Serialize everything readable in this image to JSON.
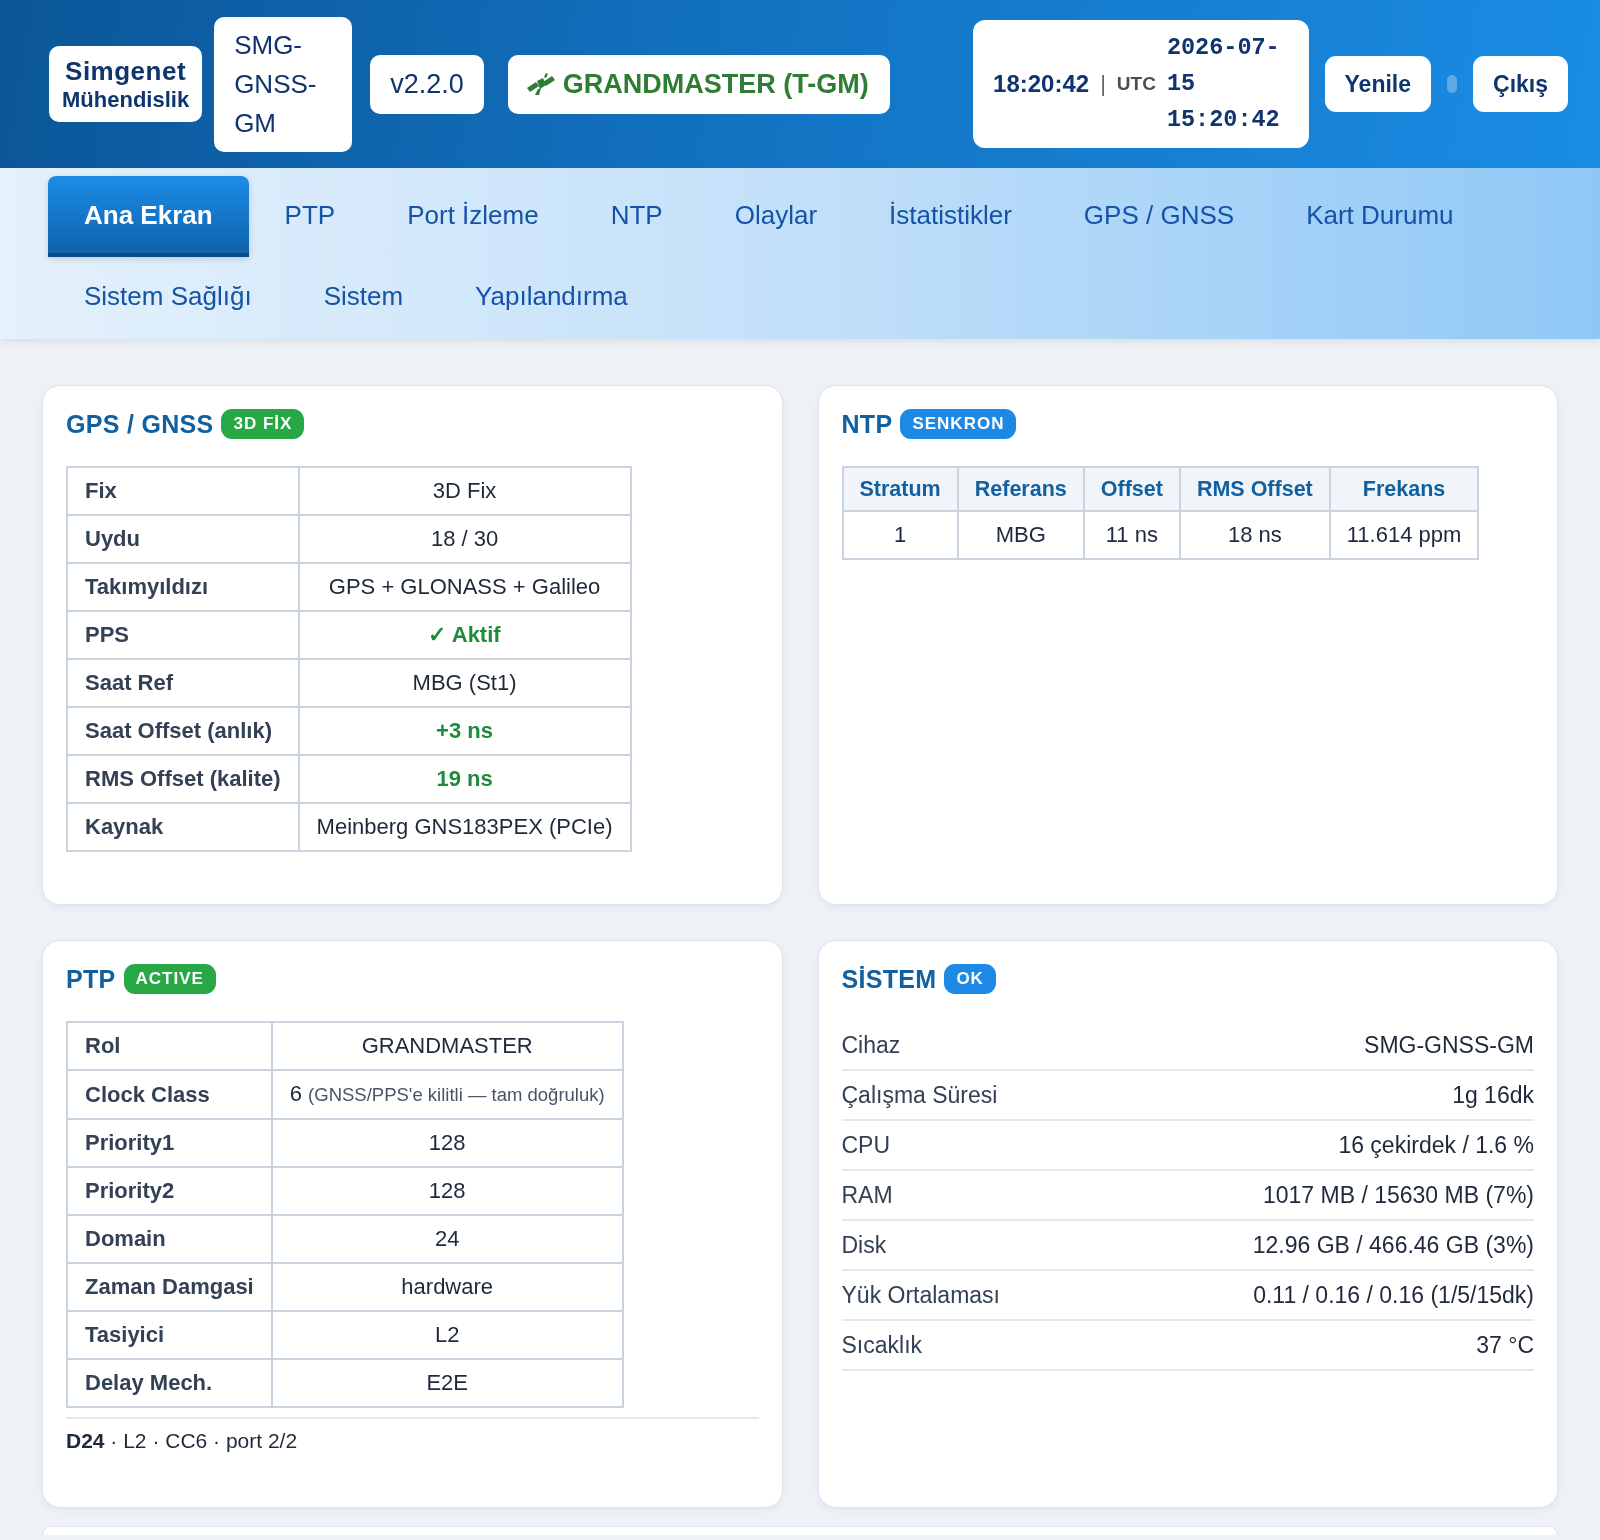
{
  "header": {
    "logo": {
      "name": "Simgenet",
      "subtitle": "Mühendislik"
    },
    "device": "SMG-GNSS-GM",
    "version": "v2.2.0",
    "role": "GRANDMASTER (T-GM)",
    "clock": {
      "local": "18:20:42",
      "separator": "|",
      "zone": "UTC",
      "utc": "2026-07-15 15:20:42"
    },
    "buttons": [
      "Yenile",
      "Çıkış"
    ]
  },
  "nav": {
    "tabs": [
      {
        "label": "Ana Ekran",
        "selected": true
      },
      {
        "label": "PTP",
        "selected": false
      },
      {
        "label": "Port İzleme",
        "selected": false
      },
      {
        "label": "NTP",
        "selected": false
      },
      {
        "label": "Olaylar",
        "selected": false
      },
      {
        "label": "İstatistikler",
        "selected": false
      },
      {
        "label": "GPS / GNSS",
        "selected": false
      },
      {
        "label": "Kart Durumu",
        "selected": false
      },
      {
        "label": "Sistem Sağlığı",
        "selected": false
      },
      {
        "label": "Sistem",
        "selected": false
      },
      {
        "label": "Yapılandırma",
        "selected": false
      }
    ]
  },
  "cards": [
    {
      "kind": "kv_table",
      "title": "GPS / GNSS",
      "badge": {
        "text": "3D FİX",
        "color": "#28a745"
      },
      "rows": [
        {
          "label": "Fix",
          "value": "3D Fix",
          "kind": "plain"
        },
        {
          "label": "Uydu",
          "value": "18 / 30",
          "kind": "plain"
        },
        {
          "label": "Takımyıldızı",
          "value": "GPS + GLONASS + Galileo",
          "kind": "plain"
        },
        {
          "label": "PPS",
          "value": "✓ Aktif",
          "kind": "good"
        },
        {
          "label": "Saat Ref",
          "value": "MBG (St1)",
          "kind": "plain"
        },
        {
          "label": "Saat Offset (anlık)",
          "value": "+3 ns",
          "kind": "good"
        },
        {
          "label": "RMS Offset (kalite)",
          "value": "19 ns",
          "kind": "good"
        },
        {
          "label": "Kaynak",
          "value": "Meinberg GNS183PEX (PCIe)",
          "kind": "plain"
        }
      ]
    },
    {
      "kind": "grid_table",
      "title": "NTP",
      "badge": {
        "text": "SENKRON",
        "color": "#1e88e5"
      },
      "columns": [
        "Stratum",
        "Referans",
        "Offset",
        "RMS Offset",
        "Frekans"
      ],
      "rows": [
        [
          "1",
          "MBG",
          "11 ns",
          "18 ns",
          "11.614 ppm"
        ]
      ]
    },
    {
      "kind": "kv_table",
      "title": "PTP",
      "badge": {
        "text": "ACTIVE",
        "color": "#28a745"
      },
      "rows": [
        {
          "label": "Rol",
          "value": "GRANDMASTER",
          "kind": "plain"
        },
        {
          "label": "Clock Class",
          "value": "6",
          "note": "(GNSS/PPS'e kilitli — tam doğruluk)",
          "kind": "plain"
        },
        {
          "label": "Priority1",
          "value": "128",
          "kind": "plain"
        },
        {
          "label": "Priority2",
          "value": "128",
          "kind": "plain"
        },
        {
          "label": "Domain",
          "value": "24",
          "kind": "plain"
        },
        {
          "label": "Zaman Damgasi",
          "value": "hardware",
          "kind": "plain"
        },
        {
          "label": "Tasiyici",
          "value": "L2",
          "kind": "plain"
        },
        {
          "label": "Delay Mech.",
          "value": "E2E",
          "kind": "plain"
        }
      ],
      "summary": "**D24** · L2 · CC6 · port 2/2"
    },
    {
      "kind": "kv_list",
      "title": "SİSTEM",
      "badge": {
        "text": "OK",
        "color": "#1e88e5"
      },
      "rows": [
        {
          "label": "Cihaz",
          "value": "SMG-GNSS-GM"
        },
        {
          "label": "Çalışma Süresi",
          "value": "1g 16dk"
        },
        {
          "label": "CPU",
          "value": "16 çekirdek / 1.6 %"
        },
        {
          "label": "RAM",
          "value": "1017 MB / 15630 MB (7%)"
        },
        {
          "label": "Disk",
          "value": "12.96 GB / 466.46 GB (3%)"
        },
        {
          "label": "Yük Ortalaması",
          "value": "0.11 / 0.16 / 0.16 (1/5/15dk)"
        },
        {
          "label": "Sıcaklık",
          "value": "37 °C"
        }
      ]
    }
  ]
}
